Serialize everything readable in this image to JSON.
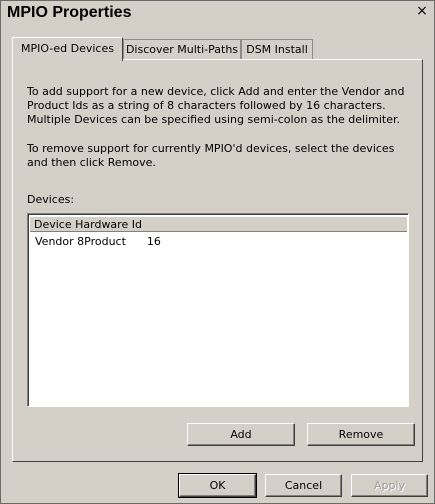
{
  "window": {
    "title": "MPIO Properties",
    "close_label": "×"
  },
  "tabs": [
    {
      "label": "MPIO-ed Devices",
      "active": true
    },
    {
      "label": "Discover Multi-Paths",
      "active": false
    },
    {
      "label": "DSM Install",
      "active": false
    }
  ],
  "panel": {
    "instructions_add": "To add support for a new device, click Add and enter the Vendor and Product Ids as a string of 8 characters followed by 16 characters. Multiple Devices can be specified using semi-colon as the delimiter.",
    "instructions_remove": "To remove support for currently MPIO'd devices, select the devices and then click Remove.",
    "devices_label": "Devices:",
    "list": {
      "column_header": "Device Hardware Id",
      "rows": [
        "Vendor 8Product      16"
      ]
    },
    "add_button": "Add",
    "remove_button": "Remove"
  },
  "footer": {
    "ok_button": "OK",
    "cancel_button": "Cancel",
    "apply_button": "Apply"
  }
}
